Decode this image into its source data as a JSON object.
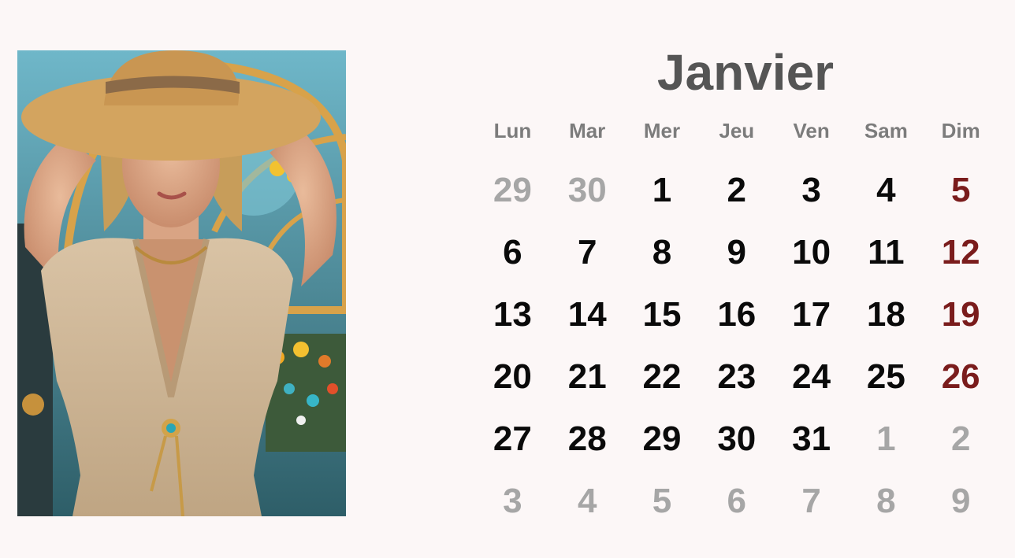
{
  "calendar": {
    "month": "Janvier",
    "weekdays": [
      "Lun",
      "Mar",
      "Mer",
      "Jeu",
      "Ven",
      "Sam",
      "Dim"
    ],
    "weeks": [
      [
        {
          "d": "29",
          "s": "muted"
        },
        {
          "d": "30",
          "s": "muted"
        },
        {
          "d": "1",
          "s": "normal"
        },
        {
          "d": "2",
          "s": "normal"
        },
        {
          "d": "3",
          "s": "normal"
        },
        {
          "d": "4",
          "s": "normal"
        },
        {
          "d": "5",
          "s": "sunday"
        }
      ],
      [
        {
          "d": "6",
          "s": "normal"
        },
        {
          "d": "7",
          "s": "normal"
        },
        {
          "d": "8",
          "s": "normal"
        },
        {
          "d": "9",
          "s": "normal"
        },
        {
          "d": "10",
          "s": "normal"
        },
        {
          "d": "11",
          "s": "normal"
        },
        {
          "d": "12",
          "s": "sunday"
        }
      ],
      [
        {
          "d": "13",
          "s": "normal"
        },
        {
          "d": "14",
          "s": "normal"
        },
        {
          "d": "15",
          "s": "normal"
        },
        {
          "d": "16",
          "s": "normal"
        },
        {
          "d": "17",
          "s": "normal"
        },
        {
          "d": "18",
          "s": "normal"
        },
        {
          "d": "19",
          "s": "sunday"
        }
      ],
      [
        {
          "d": "20",
          "s": "normal"
        },
        {
          "d": "21",
          "s": "normal"
        },
        {
          "d": "22",
          "s": "normal"
        },
        {
          "d": "23",
          "s": "normal"
        },
        {
          "d": "24",
          "s": "normal"
        },
        {
          "d": "25",
          "s": "normal"
        },
        {
          "d": "26",
          "s": "sunday"
        }
      ],
      [
        {
          "d": "27",
          "s": "normal"
        },
        {
          "d": "28",
          "s": "normal"
        },
        {
          "d": "29",
          "s": "normal"
        },
        {
          "d": "30",
          "s": "normal"
        },
        {
          "d": "31",
          "s": "normal"
        },
        {
          "d": "1",
          "s": "muted"
        },
        {
          "d": "2",
          "s": "muted"
        }
      ],
      [
        {
          "d": "3",
          "s": "muted"
        },
        {
          "d": "4",
          "s": "muted"
        },
        {
          "d": "5",
          "s": "muted"
        },
        {
          "d": "6",
          "s": "muted"
        },
        {
          "d": "7",
          "s": "muted"
        },
        {
          "d": "8",
          "s": "muted"
        },
        {
          "d": "9",
          "s": "muted"
        }
      ]
    ]
  },
  "colors": {
    "background": "#fcf7f7",
    "title": "#555555",
    "weekday": "#7c7c7c",
    "day": "#0a0a0a",
    "muted": "#a6a6a6",
    "sunday": "#7a1c1c"
  }
}
